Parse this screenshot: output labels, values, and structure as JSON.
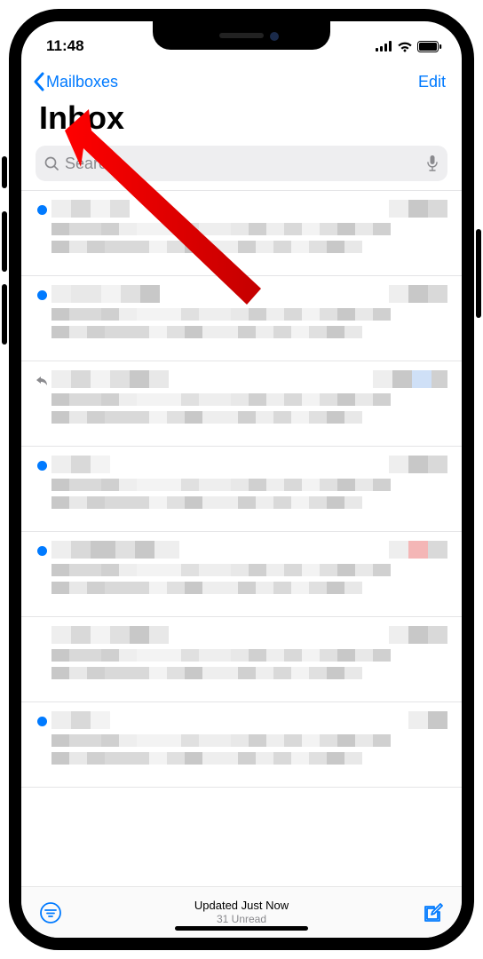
{
  "status": {
    "time": "11:48"
  },
  "nav": {
    "back_label": "Mailboxes",
    "edit_label": "Edit"
  },
  "page": {
    "title": "Inbox"
  },
  "search": {
    "placeholder": "Search"
  },
  "messages": [
    {
      "unread": true,
      "replied": false
    },
    {
      "unread": true,
      "replied": false
    },
    {
      "unread": false,
      "replied": true
    },
    {
      "unread": true,
      "replied": false
    },
    {
      "unread": true,
      "replied": false
    },
    {
      "unread": false,
      "replied": false
    },
    {
      "unread": true,
      "replied": false
    }
  ],
  "footer": {
    "status_line1": "Updated Just Now",
    "status_line2": "31 Unread"
  }
}
